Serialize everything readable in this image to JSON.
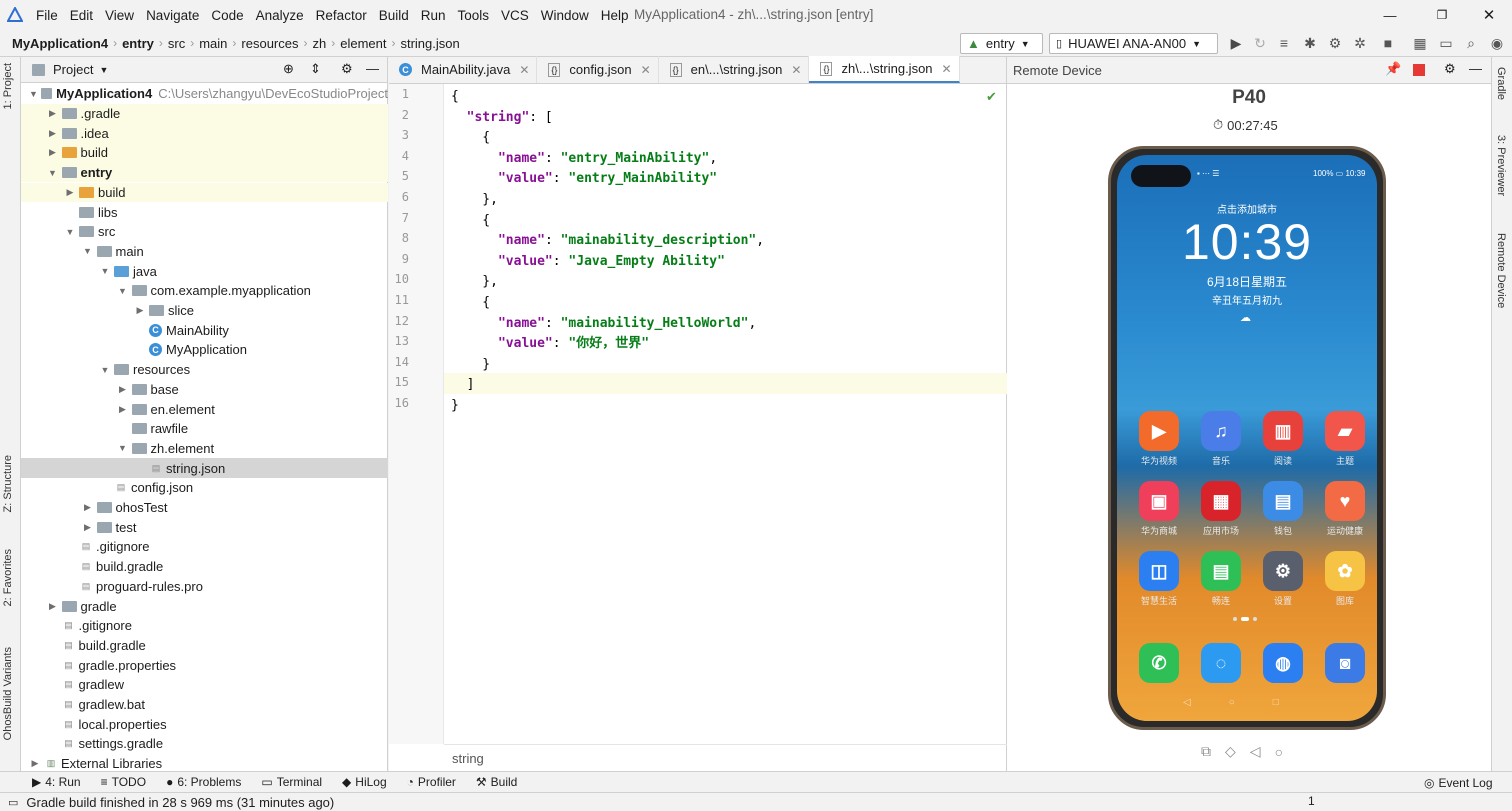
{
  "menu": {
    "items": [
      "File",
      "Edit",
      "View",
      "Navigate",
      "Code",
      "Analyze",
      "Refactor",
      "Build",
      "Run",
      "Tools",
      "VCS",
      "Window",
      "Help"
    ],
    "window_title": "MyApplication4 - zh\\...\\string.json [entry]"
  },
  "breadcrumb": [
    "MyApplication4",
    "entry",
    "src",
    "main",
    "resources",
    "zh",
    "element",
    "string.json"
  ],
  "toolbar": {
    "module": "entry",
    "device": "HUAWEI ANA-AN00"
  },
  "left_strip": {
    "project": "1: Project",
    "structure": "Z: Structure",
    "favorites": "2: Favorites",
    "ohos_variants": "OhosBuild Variants"
  },
  "right_strip": {
    "gradle": "Gradle",
    "previewer": "3: Previewer",
    "remote": "Remote Device"
  },
  "project_panel": {
    "title": "Project",
    "tree": [
      {
        "label": "MyApplication4",
        "hint": "C:\\Users\\zhangyu\\DevEcoStudioProject",
        "bold": true
      },
      {
        "label": ".gradle"
      },
      {
        "label": ".idea"
      },
      {
        "label": "build"
      },
      {
        "label": "entry",
        "bold": true
      },
      {
        "label": "build"
      },
      {
        "label": "libs"
      },
      {
        "label": "src"
      },
      {
        "label": "main"
      },
      {
        "label": "java"
      },
      {
        "label": "com.example.myapplication"
      },
      {
        "label": "slice"
      },
      {
        "label": "MainAbility"
      },
      {
        "label": "MyApplication"
      },
      {
        "label": "resources"
      },
      {
        "label": "base"
      },
      {
        "label": "en.element"
      },
      {
        "label": "rawfile"
      },
      {
        "label": "zh.element"
      },
      {
        "label": "string.json"
      },
      {
        "label": "config.json"
      },
      {
        "label": "ohosTest"
      },
      {
        "label": "test"
      },
      {
        "label": ".gitignore"
      },
      {
        "label": "build.gradle"
      },
      {
        "label": "proguard-rules.pro"
      },
      {
        "label": "gradle"
      },
      {
        "label": ".gitignore"
      },
      {
        "label": "build.gradle"
      },
      {
        "label": "gradle.properties"
      },
      {
        "label": "gradlew"
      },
      {
        "label": "gradlew.bat"
      },
      {
        "label": "local.properties"
      },
      {
        "label": "settings.gradle"
      },
      {
        "label": "External Libraries"
      }
    ]
  },
  "editor": {
    "tabs": [
      {
        "label": "MainAbility.java"
      },
      {
        "label": "config.json"
      },
      {
        "label": "en\\...\\string.json"
      },
      {
        "label": "zh\\...\\string.json"
      }
    ],
    "line_numbers": [
      "1",
      "2",
      "3",
      "4",
      "5",
      "6",
      "7",
      "8",
      "9",
      "10",
      "11",
      "12",
      "13",
      "14",
      "15",
      "16"
    ],
    "lines": [
      {
        "t": "{"
      },
      {
        "t": "  \"string\": ["
      },
      {
        "t": "    {"
      },
      {
        "t": "      \"name\": \"entry_MainAbility\","
      },
      {
        "t": "      \"value\": \"entry_MainAbility\""
      },
      {
        "t": "    },"
      },
      {
        "t": "    {"
      },
      {
        "t": "      \"name\": \"mainability_description\","
      },
      {
        "t": "      \"value\": \"Java_Empty Ability\""
      },
      {
        "t": "    },"
      },
      {
        "t": "    {"
      },
      {
        "t": "      \"name\": \"mainability_HelloWorld\","
      },
      {
        "t": "      \"value\": \"你好，世界\""
      },
      {
        "t": "    }"
      },
      {
        "t": "  ]"
      },
      {
        "t": "}"
      }
    ],
    "footer_crumb": "string"
  },
  "remote": {
    "title": "Remote Device",
    "device_name": "P40",
    "timer": "00:27:45",
    "phone": {
      "status_right": "100% ▭ 10:39",
      "city": "点击添加城市",
      "time": "10:39",
      "date": "6月18日星期五",
      "lunar": "辛丑年五月初九",
      "apps": [
        {
          "label": "华为视频",
          "color": "#f26b2b"
        },
        {
          "label": "音乐",
          "color": "#4a7de8"
        },
        {
          "label": "阅读",
          "color": "#e8403a"
        },
        {
          "label": "主题",
          "color": "#f2554a"
        },
        {
          "label": "华为商城",
          "color": "#ef3f5b"
        },
        {
          "label": "应用市场",
          "color": "#d8232a"
        },
        {
          "label": "钱包",
          "color": "#3c8ce6"
        },
        {
          "label": "运动健康",
          "color": "#f36b45"
        },
        {
          "label": "智慧生活",
          "color": "#2b7ff0"
        },
        {
          "label": "畅连",
          "color": "#2fbf57"
        },
        {
          "label": "设置",
          "color": "#5a5f6e"
        },
        {
          "label": "图库",
          "color": "#f6c344"
        }
      ],
      "dock": [
        {
          "color": "#2fbf57"
        },
        {
          "color": "#2b9af0"
        },
        {
          "color": "#2b7ff0"
        },
        {
          "color": "#3c7be6"
        }
      ]
    }
  },
  "toolwindows": [
    "4: Run",
    "TODO",
    "6: Problems",
    "Terminal",
    "HiLog",
    "Profiler",
    "Build"
  ],
  "event_log": "Event Log",
  "status": {
    "message": "Gradle build finished in 28 s 969 ms (31 minutes ago)",
    "position": "1"
  }
}
